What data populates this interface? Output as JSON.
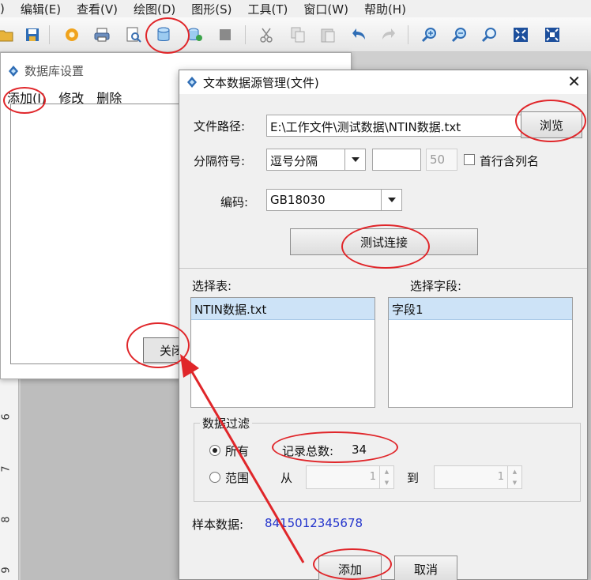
{
  "menubar": {
    "items": [
      "编辑(E)",
      "查看(V)",
      "绘图(D)",
      "图形(S)",
      "工具(T)",
      "窗口(W)",
      "帮助(H)"
    ],
    "leading_fragment": ")"
  },
  "toolbar": {
    "icons": [
      "open-icon",
      "save-icon",
      "settings-icon",
      "print-icon",
      "print-preview-icon",
      "database-icon",
      "database-settings-icon",
      "stop-icon",
      "cut-icon",
      "copy-icon",
      "paste-icon",
      "undo-icon",
      "redo-icon",
      "zoom-in-icon",
      "zoom-out-icon",
      "zoom-fit-icon",
      "fit-page-icon",
      "fit-width-icon"
    ]
  },
  "ruler": {
    "numbers": [
      "6",
      "7",
      "8",
      "9"
    ]
  },
  "db_window": {
    "title": "数据库设置",
    "menu": {
      "add": "添加(I)",
      "modify": "修改",
      "delete": "删除"
    },
    "close_button": "关闭"
  },
  "dialog": {
    "title": "文本数据源管理(文件)",
    "file_path_label": "文件路径:",
    "file_path_value": "E:\\工作文件\\测试数据\\NTIN数据.txt",
    "browse_button": "浏览",
    "separator_label": "分隔符号:",
    "separator_value": "逗号分隔",
    "separator_extra_value": "",
    "separator_limit": "50",
    "first_row_header_label": "首行含列名",
    "encoding_label": "编码:",
    "encoding_value": "GB18030",
    "test_connection_button": "测试连接",
    "select_table_label": "选择表:",
    "tables": [
      "NTIN数据.txt"
    ],
    "select_field_label": "选择字段:",
    "fields": [
      "字段1"
    ],
    "filter_group_label": "数据过滤",
    "filter_all_label": "所有",
    "record_total_label": "记录总数:",
    "record_total_value": "34",
    "filter_range_label": "范围",
    "range_from_label": "从",
    "range_from_value": "1",
    "range_to_label": "到",
    "range_to_value": "1",
    "sample_label": "样本数据:",
    "sample_value": "8415012345678",
    "add_button": "添加",
    "cancel_button": "取消"
  },
  "colors": {
    "annotation": "#e0262a",
    "selection": "#cde3f7",
    "sample_text": "#2233cc"
  }
}
